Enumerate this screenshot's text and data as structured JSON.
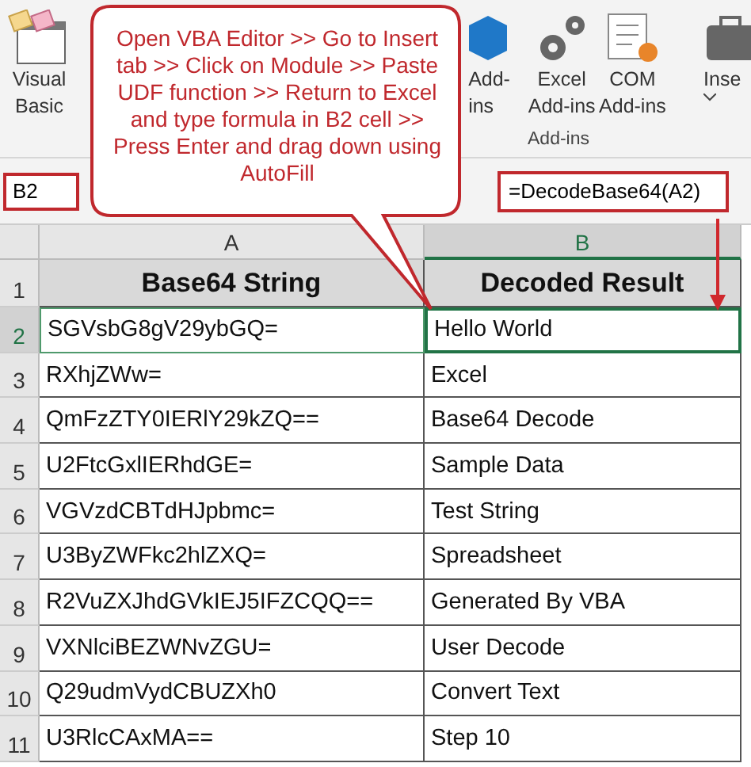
{
  "ribbon": {
    "buttons": [
      {
        "kind": "vba",
        "lines": [
          "Visual",
          "Basic"
        ]
      },
      {
        "kind": "cube",
        "lines": [
          "Add-",
          "ins"
        ]
      },
      {
        "kind": "gears",
        "lines": [
          "Excel",
          "Add-ins"
        ]
      },
      {
        "kind": "list",
        "lines": [
          "COM",
          "Add-ins"
        ]
      },
      {
        "kind": "case",
        "lines": [
          "Inse"
        ]
      }
    ],
    "group_label": "Add-ins"
  },
  "name_box": "B2",
  "formula": "=DecodeBase64(A2)",
  "callout": "Open VBA Editor >> Go to Insert tab >> Click on Module >> Paste UDF function >> Return to Excel and type formula in B2 cell >> Press Enter and drag down using AutoFill",
  "columns": [
    {
      "label": "A",
      "selected": false
    },
    {
      "label": "B",
      "selected": true
    }
  ],
  "header_row": {
    "number": "1",
    "cells": [
      "Base64 String",
      "Decoded Result"
    ]
  },
  "rows": [
    {
      "number": "2",
      "cells": [
        "SGVsbG8gV29ybGQ=",
        "Hello World"
      ],
      "selected": true
    },
    {
      "number": "3",
      "cells": [
        "RXhjZWw=",
        "Excel"
      ],
      "selected": false
    },
    {
      "number": "4",
      "cells": [
        "QmFzZTY0IERlY29kZQ==",
        "Base64 Decode"
      ],
      "selected": false
    },
    {
      "number": "5",
      "cells": [
        "U2FtcGxlIERhdGE=",
        "Sample Data"
      ],
      "selected": false
    },
    {
      "number": "6",
      "cells": [
        "VGVzdCBTdHJpbmc=",
        "Test String"
      ],
      "selected": false
    },
    {
      "number": "7",
      "cells": [
        "U3ByZWFkc2hlZXQ=",
        "Spreadsheet"
      ],
      "selected": false
    },
    {
      "number": "8",
      "cells": [
        "R2VuZXJhdGVkIEJ5IFZCQQ==",
        "Generated By VBA"
      ],
      "selected": false
    },
    {
      "number": "9",
      "cells": [
        "VXNlciBEZWNvZGU=",
        "User Decode"
      ],
      "selected": false
    },
    {
      "number": "10",
      "cells": [
        "Q29udmVydCBUZXh0",
        "Convert Text"
      ],
      "selected": false
    },
    {
      "number": "11",
      "cells": [
        "U3RlcCAxMA==",
        "Step 10"
      ],
      "selected": false
    }
  ]
}
